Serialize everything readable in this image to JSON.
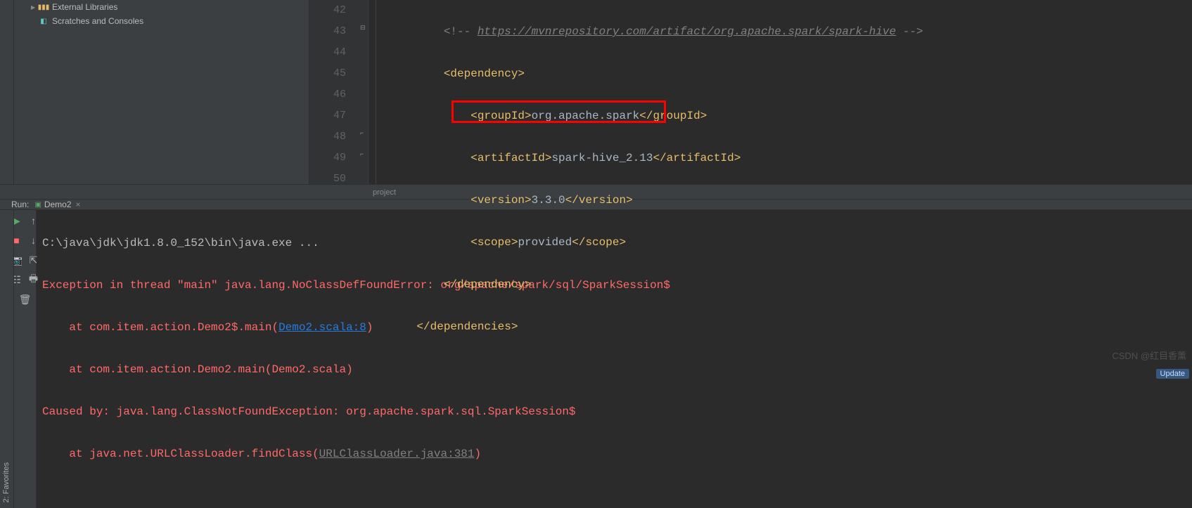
{
  "tree": {
    "libs_label": "External Libraries",
    "scratch_label": "Scratches and Consoles"
  },
  "gutter": [
    "42",
    "43",
    "44",
    "45",
    "46",
    "47",
    "48",
    "49",
    "50"
  ],
  "code": {
    "l42_pre": "        <!-- ",
    "l42_link": "https://mvnrepository.com/artifact/org.apache.spark/spark-hive",
    "l42_post": " -->",
    "l43_tag": "        <dependency>",
    "l44_open": "            <groupId>",
    "l44_text": "org.apache.spark",
    "l44_close": "</groupId>",
    "l45_open": "            <artifactId>",
    "l45_text": "spark-hive_2.13",
    "l45_close": "</artifactId>",
    "l46_open": "            <version>",
    "l46_text": "3.3.0",
    "l46_close": "</version>",
    "l47_open": "            <scope>",
    "l47_text": "provided",
    "l47_close": "</scope>",
    "l48_tag": "        </dependency>",
    "l49_tag": "    </dependencies>"
  },
  "breadcrumb": "project",
  "run": {
    "title": "Run:",
    "tab": "Demo2",
    "left_label": "2: Favorites"
  },
  "console": {
    "l1": "C:\\java\\jdk\\jdk1.8.0_152\\bin\\java.exe ...",
    "l2": "Exception in thread \"main\" java.lang.NoClassDefFoundError: org/apache/spark/sql/SparkSession$",
    "l3_pre": "    at com.item.action.Demo2$.main(",
    "l3_link": "Demo2.scala:8",
    "l3_post": ")",
    "l4": "    at com.item.action.Demo2.main(Demo2.scala)",
    "l5": "Caused by: java.lang.ClassNotFoundException: org.apache.spark.sql.SparkSession$",
    "l6_pre": "    at java.net.URLClassLoader.findClass(",
    "l6_link": "URLClassLoader.java:381",
    "l6_post": ")"
  },
  "watermark": "CSDN @红目香薰",
  "update": "Update"
}
